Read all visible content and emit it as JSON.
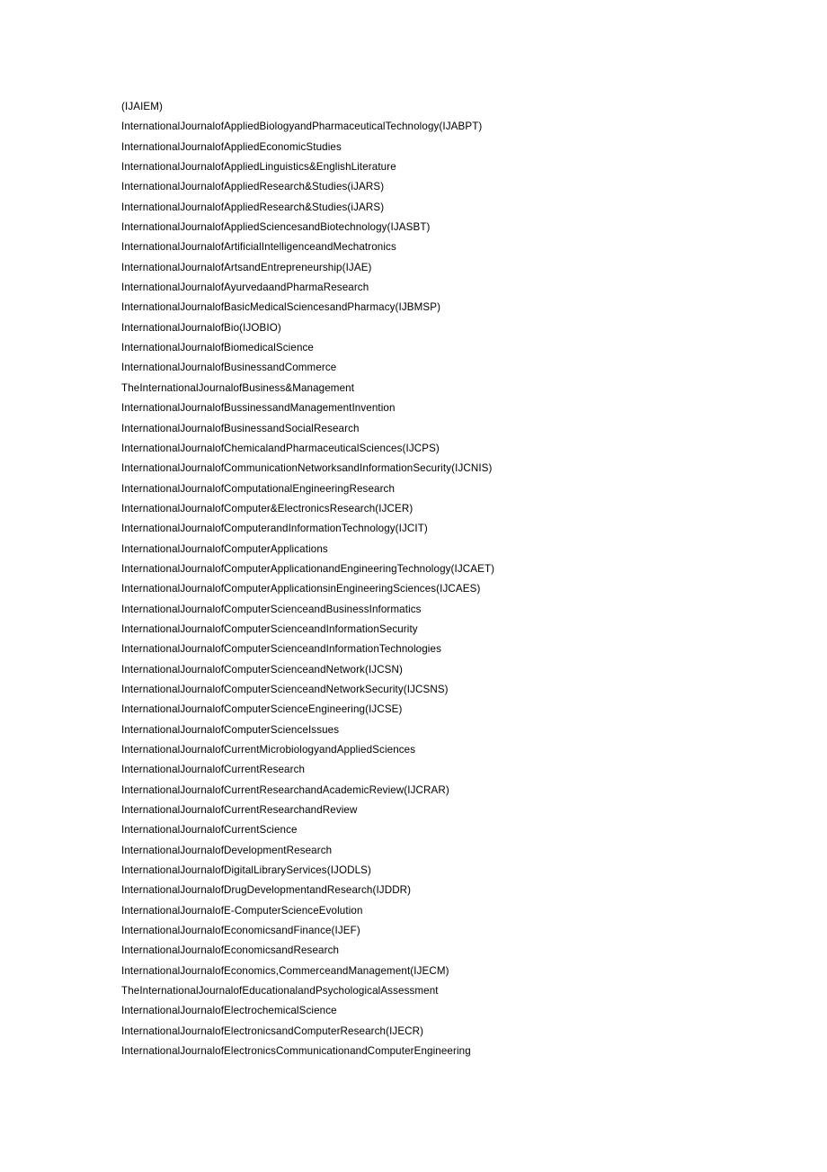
{
  "document": {
    "type": "plain-text-page",
    "page_background": "#ffffff",
    "text_color": "#000000",
    "lines": [
      "(IJAIEM)",
      "InternationalJournalofAppliedBiologyandPharmaceuticalTechnology(IJABPT)",
      "InternationalJournalofAppliedEconomicStudies",
      "InternationalJournalofAppliedLinguistics&EnglishLiterature",
      "InternationalJournalofAppliedResearch&Studies(iJARS)",
      "InternationalJournalofAppliedResearch&Studies(iJARS)",
      "InternationalJournalofAppliedSciencesandBiotechnology(IJASBT)",
      "InternationalJournalofArtificialIntelligenceandMechatronics",
      "InternationalJournalofArtsandEntrepreneurship(IJAE)",
      "InternationalJournalofAyurvedaandPharmaResearch",
      "InternationalJournalofBasicMedicalSciencesandPharmacy(IJBMSP)",
      "InternationalJournalofBio(IJOBIO)",
      "InternationalJournalofBiomedicalScience",
      "InternationalJournalofBusinessandCommerce",
      "TheInternationalJournalofBusiness&Management",
      "InternationalJournalofBussinessandManagementInvention",
      "InternationalJournalofBusinessandSocialResearch",
      "InternationalJournalofChemicalandPharmaceuticalSciences(IJCPS)",
      "InternationalJournalofCommunicationNetworksandInformationSecurity(IJCNIS)",
      "InternationalJournalofComputationalEngineeringResearch",
      "InternationalJournalofComputer&ElectronicsResearch(IJCER)",
      "InternationalJournalofComputerandInformationTechnology(IJCIT)",
      "InternationalJournalofComputerApplications",
      "InternationalJournalofComputerApplicationandEngineeringTechnology(IJCAET)",
      "InternationalJournalofComputerApplicationsinEngineeringSciences(IJCAES)",
      "InternationalJournalofComputerScienceandBusinessInformatics",
      "InternationalJournalofComputerScienceandInformationSecurity",
      "InternationalJournalofComputerScienceandInformationTechnologies",
      "InternationalJournalofComputerScienceandNetwork(IJCSN)",
      "InternationalJournalofComputerScienceandNetworkSecurity(IJCSNS)",
      "InternationalJournalofComputerScienceEngineering(IJCSE)",
      "InternationalJournalofComputerScienceIssues",
      "InternationalJournalofCurrentMicrobiologyandAppliedSciences",
      "InternationalJournalofCurrentResearch",
      "InternationalJournalofCurrentResearchandAcademicReview(IJCRAR)",
      "InternationalJournalofCurrentResearchandReview",
      "InternationalJournalofCurrentScience",
      "InternationalJournalofDevelopmentResearch",
      "InternationalJournalofDigitalLibraryServices(IJODLS)",
      "InternationalJournalofDrugDevelopmentandResearch(IJDDR)",
      "InternationalJournalofE-ComputerScienceEvolution",
      "InternationalJournalofEconomicsandFinance(IJEF)",
      "InternationalJournalofEconomicsandResearch",
      "InternationalJournalofEconomics,CommerceandManagement(IJECM)",
      "TheInternationalJournalofEducationalandPsychologicalAssessment",
      "InternationalJournalofElectrochemicalScience",
      "InternationalJournalofElectronicsandComputerResearch(IJECR)",
      "InternationalJournalofElectronicsCommunicationandComputerEngineering"
    ]
  }
}
